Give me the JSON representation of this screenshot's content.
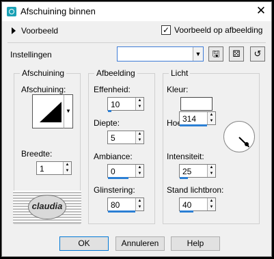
{
  "window": {
    "title": "Afschuining binnen"
  },
  "preview": {
    "toggle_label": "Voorbeeld",
    "checkbox_label": "Voorbeeld op afbeelding",
    "checked": true
  },
  "settings": {
    "label": "Instellingen",
    "preset_value": ""
  },
  "bevel_group": {
    "title": "Afschuining",
    "bevel_label": "Afschuining:",
    "width_label": "Breedte:",
    "width_value": "1"
  },
  "image_group": {
    "title": "Afbeelding",
    "smoothness_label": "Effenheid:",
    "smoothness_value": "10",
    "depth_label": "Diepte:",
    "depth_value": "5",
    "ambience_label": "Ambiance:",
    "ambience_value": "0",
    "shininess_label": "Glinstering:",
    "shininess_value": "80"
  },
  "light_group": {
    "title": "Licht",
    "color_label": "Kleur:",
    "color_value": "#ffffff",
    "angle_label": "Hoek:",
    "angle_value": "314",
    "intensity_label": "Intensiteit:",
    "intensity_value": "25",
    "elevation_label": "Stand lichtbron:",
    "elevation_value": "40"
  },
  "logo": {
    "text": "claudia"
  },
  "buttons": {
    "ok": "OK",
    "cancel": "Annuleren",
    "help": "Help"
  },
  "icons": [
    "close-icon",
    "expand-triangle-icon",
    "save-preset-icon",
    "random-dice-icon",
    "reset-icon",
    "chevron-down-icon",
    "spin-arrows-icon",
    "light-angle-dial-icon"
  ]
}
